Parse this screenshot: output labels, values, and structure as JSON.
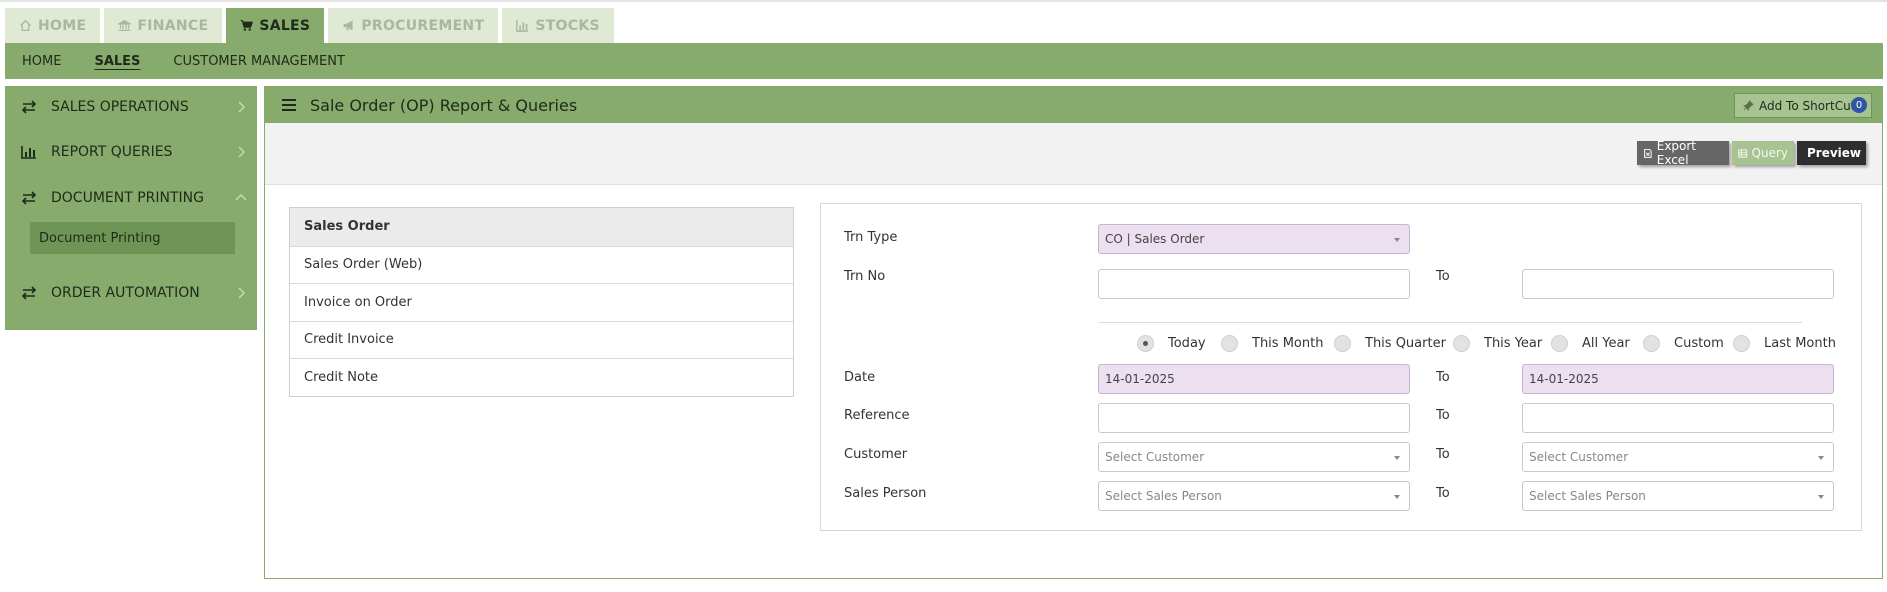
{
  "main_tabs": [
    {
      "label": "HOME",
      "icon": "home-icon",
      "active": false
    },
    {
      "label": "FINANCE",
      "icon": "bank-icon",
      "active": false
    },
    {
      "label": "SALES",
      "icon": "cart-icon",
      "active": true
    },
    {
      "label": "PROCUREMENT",
      "icon": "megaphone-icon",
      "active": false
    },
    {
      "label": "STOCKS",
      "icon": "bar-chart-icon",
      "active": false
    }
  ],
  "sub_nav": [
    {
      "label": "HOME",
      "active": false
    },
    {
      "label": "SALES",
      "active": true
    },
    {
      "label": "CUSTOMER MANAGEMENT",
      "active": false
    }
  ],
  "sidebar": {
    "items": [
      {
        "label": "SALES OPERATIONS",
        "icon": "exchange-icon",
        "expanded": false
      },
      {
        "label": "REPORT QUERIES",
        "icon": "bar-chart-icon",
        "expanded": false
      },
      {
        "label": "DOCUMENT PRINTING",
        "icon": "exchange-icon",
        "expanded": true
      },
      {
        "label": "ORDER AUTOMATION",
        "icon": "exchange-icon",
        "expanded": false
      }
    ],
    "sub_item": "Document Printing"
  },
  "panel": {
    "title": "Sale Order (OP) Report & Queries",
    "shortcut_label": "Add To ShortCut",
    "shortcut_count": "0"
  },
  "toolbar": {
    "export_label": "Export Excel",
    "query_label": "Query",
    "preview_label": "Preview"
  },
  "reports": [
    "Sales Order",
    "Sales Order (Web)",
    "Invoice on Order",
    "Credit Invoice",
    "Credit Note"
  ],
  "form": {
    "trn_type_label": "Trn Type",
    "trn_type_value": "CO | Sales Order",
    "trn_no_label": "Trn No",
    "trn_no_from": "",
    "trn_no_to": "",
    "to_label": "To",
    "date_label": "Date",
    "date_from": "14-01-2025",
    "date_to": "14-01-2025",
    "reference_label": "Reference",
    "reference_from": "",
    "reference_to": "",
    "customer_label": "Customer",
    "customer_placeholder": "Select Customer",
    "sales_person_label": "Sales Person",
    "sales_person_placeholder": "Select Sales Person",
    "periods": [
      "Today",
      "This Month",
      "This Quarter",
      "This Year",
      "All Year",
      "Custom",
      "Last Month"
    ],
    "selected_period": "Today"
  },
  "colors": {
    "accent": "#86ab6c",
    "accent_light": "#dfe9d3",
    "filled_input": "#ebdff0"
  }
}
